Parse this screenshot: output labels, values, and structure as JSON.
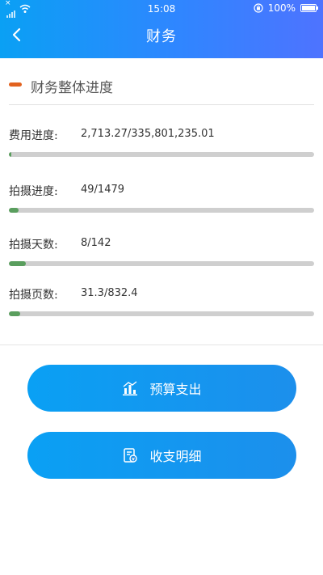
{
  "status_bar": {
    "time": "15:08",
    "battery": "100%",
    "signal_icon": "signal-icon",
    "wifi_icon": "wifi-icon",
    "rotation_lock_icon": "rotation-lock-icon"
  },
  "header": {
    "title": "财务",
    "back_icon": "chevron-left-icon"
  },
  "section": {
    "title": "财务整体进度",
    "marker_color": "#e2621f"
  },
  "metrics": [
    {
      "label": "费用进度:",
      "value": "2,713.27/335,801,235.01",
      "progress": 0.008
    },
    {
      "label": "拍摄进度:",
      "value": "49/1479",
      "progress": 0.033
    },
    {
      "label": "拍摄天数:",
      "value": "8/142",
      "progress": 0.056
    },
    {
      "label": "拍摄页数:",
      "value": "31.3/832.4",
      "progress": 0.038
    }
  ],
  "actions": {
    "budget_expense_label": "预算支出",
    "budget_expense_icon": "bar-chart-icon",
    "income_expense_label": "收支明细",
    "income_expense_icon": "ledger-icon"
  },
  "colors": {
    "header_gradient_start": "#0aa0f4",
    "header_gradient_end": "#4e73ff",
    "progress_fill": "#5a9e5e",
    "progress_track": "#cfcfcf",
    "button": "#1c98ef"
  }
}
